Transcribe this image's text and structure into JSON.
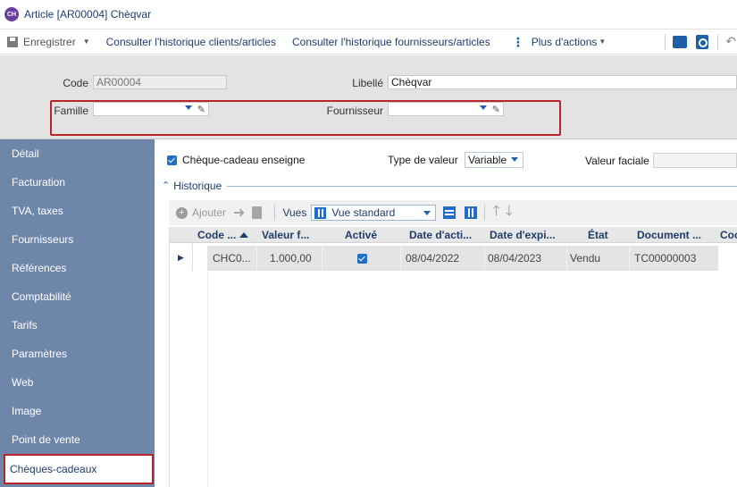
{
  "window": {
    "logo_text": "CH",
    "title": "Article [AR00004] Chèqvar"
  },
  "toolbar": {
    "save": "Enregistrer",
    "hist_clients": "Consulter l'historique clients/articles",
    "hist_fournisseurs": "Consulter l'historique fournisseurs/articles",
    "more": "Plus d'actions"
  },
  "header": {
    "code_label": "Code",
    "code_value": "AR00004",
    "libelle_label": "Libellé",
    "libelle_value": "Chèqvar",
    "famille_label": "Famille",
    "famille_value": "",
    "fournisseur_label": "Fournisseur",
    "fournisseur_value": ""
  },
  "sidebar": {
    "items": [
      {
        "label": "Détail"
      },
      {
        "label": "Facturation"
      },
      {
        "label": "TVA, taxes"
      },
      {
        "label": "Fournisseurs"
      },
      {
        "label": "Références"
      },
      {
        "label": "Comptabilité"
      },
      {
        "label": "Tarifs"
      },
      {
        "label": "Paramètres"
      },
      {
        "label": "Web"
      },
      {
        "label": "Image"
      },
      {
        "label": "Point de vente"
      },
      {
        "label": "Chèques-cadeaux"
      }
    ],
    "active_index": 11
  },
  "main": {
    "cheque_enseigne_label": "Chèque-cadeau enseigne",
    "cheque_enseigne_checked": true,
    "type_valeur_label": "Type de valeur",
    "type_valeur_value": "Variable",
    "valeur_faciale_label": "Valeur faciale",
    "valeur_faciale_value": "",
    "historique_label": "Historique",
    "grid_toolbar": {
      "add_label": "Ajouter",
      "vues_label": "Vues",
      "vue_selected": "Vue standard"
    },
    "columns": [
      "Code ...",
      "Valeur f...",
      "Activé",
      "Date d'acti...",
      "Date d'expi...",
      "État",
      "Document ...",
      "Coc"
    ],
    "rows": [
      {
        "code": "CHC0...",
        "valeur": "1.000,00",
        "active": true,
        "date_activation": "08/04/2022",
        "date_expiration": "08/04/2023",
        "etat": "Vendu",
        "document": "TC00000003"
      }
    ]
  },
  "colors": {
    "sidebar_bg": "#6f86ab",
    "accent": "#1f6fc8",
    "highlight": "#b8262c",
    "header_bg": "#e3e3e3"
  }
}
